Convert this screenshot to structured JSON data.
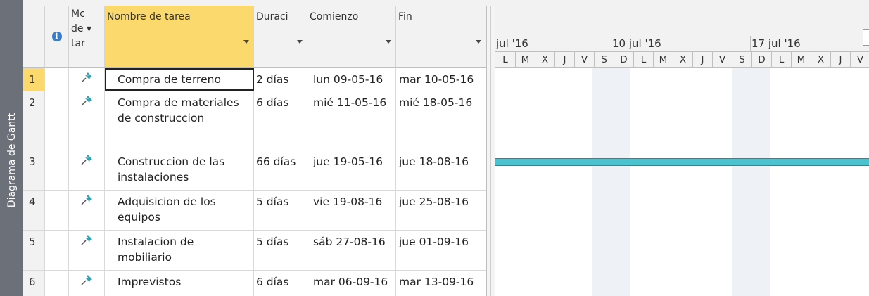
{
  "sidebar": {
    "label": "Diagrama de Gantt"
  },
  "columns": {
    "mode": "Mo de tar",
    "mode_lines": [
      "Mc",
      "de ▾",
      "tar"
    ],
    "name": "Nombre de tarea",
    "duration": "Duraci",
    "start": "Comienzo",
    "finish": "Fin"
  },
  "tasks": [
    {
      "id": "1",
      "name": "Compra de terreno",
      "duration": "2 días",
      "start": "lun 09-05-16",
      "finish": "mar 10-05-16"
    },
    {
      "id": "2",
      "name": "Compra de materiales de construccion",
      "duration": "6 días",
      "start": "mié 11-05-16",
      "finish": "mié 18-05-16"
    },
    {
      "id": "3",
      "name": "Construccion de las instalaciones",
      "duration": "66 días",
      "start": "jue 19-05-16",
      "finish": "jue 18-08-16"
    },
    {
      "id": "4",
      "name": "Adquisicion de los equipos",
      "duration": "5 días",
      "start": "vie 19-08-16",
      "finish": "jue 25-08-16"
    },
    {
      "id": "5",
      "name": "Instalacion de mobiliario",
      "duration": "5 días",
      "start": "sáb 27-08-16",
      "finish": "jue 01-09-16"
    },
    {
      "id": "6",
      "name": "Imprevistos",
      "duration": "6 días",
      "start": "mar 06-09-16",
      "finish": "mar 13-09-16"
    }
  ],
  "timeline": {
    "weeks": [
      "jul '16",
      "10 jul '16",
      "17 jul '16"
    ],
    "days": [
      "L",
      "M",
      "X",
      "J",
      "V",
      "S",
      "D",
      "L",
      "M",
      "X",
      "J",
      "V",
      "S",
      "D",
      "L",
      "M",
      "X",
      "J",
      "V"
    ]
  },
  "colors": {
    "selected": "#fbd96c",
    "gantt_bar": "#4cc2cf",
    "sidebar": "#6c7079"
  }
}
